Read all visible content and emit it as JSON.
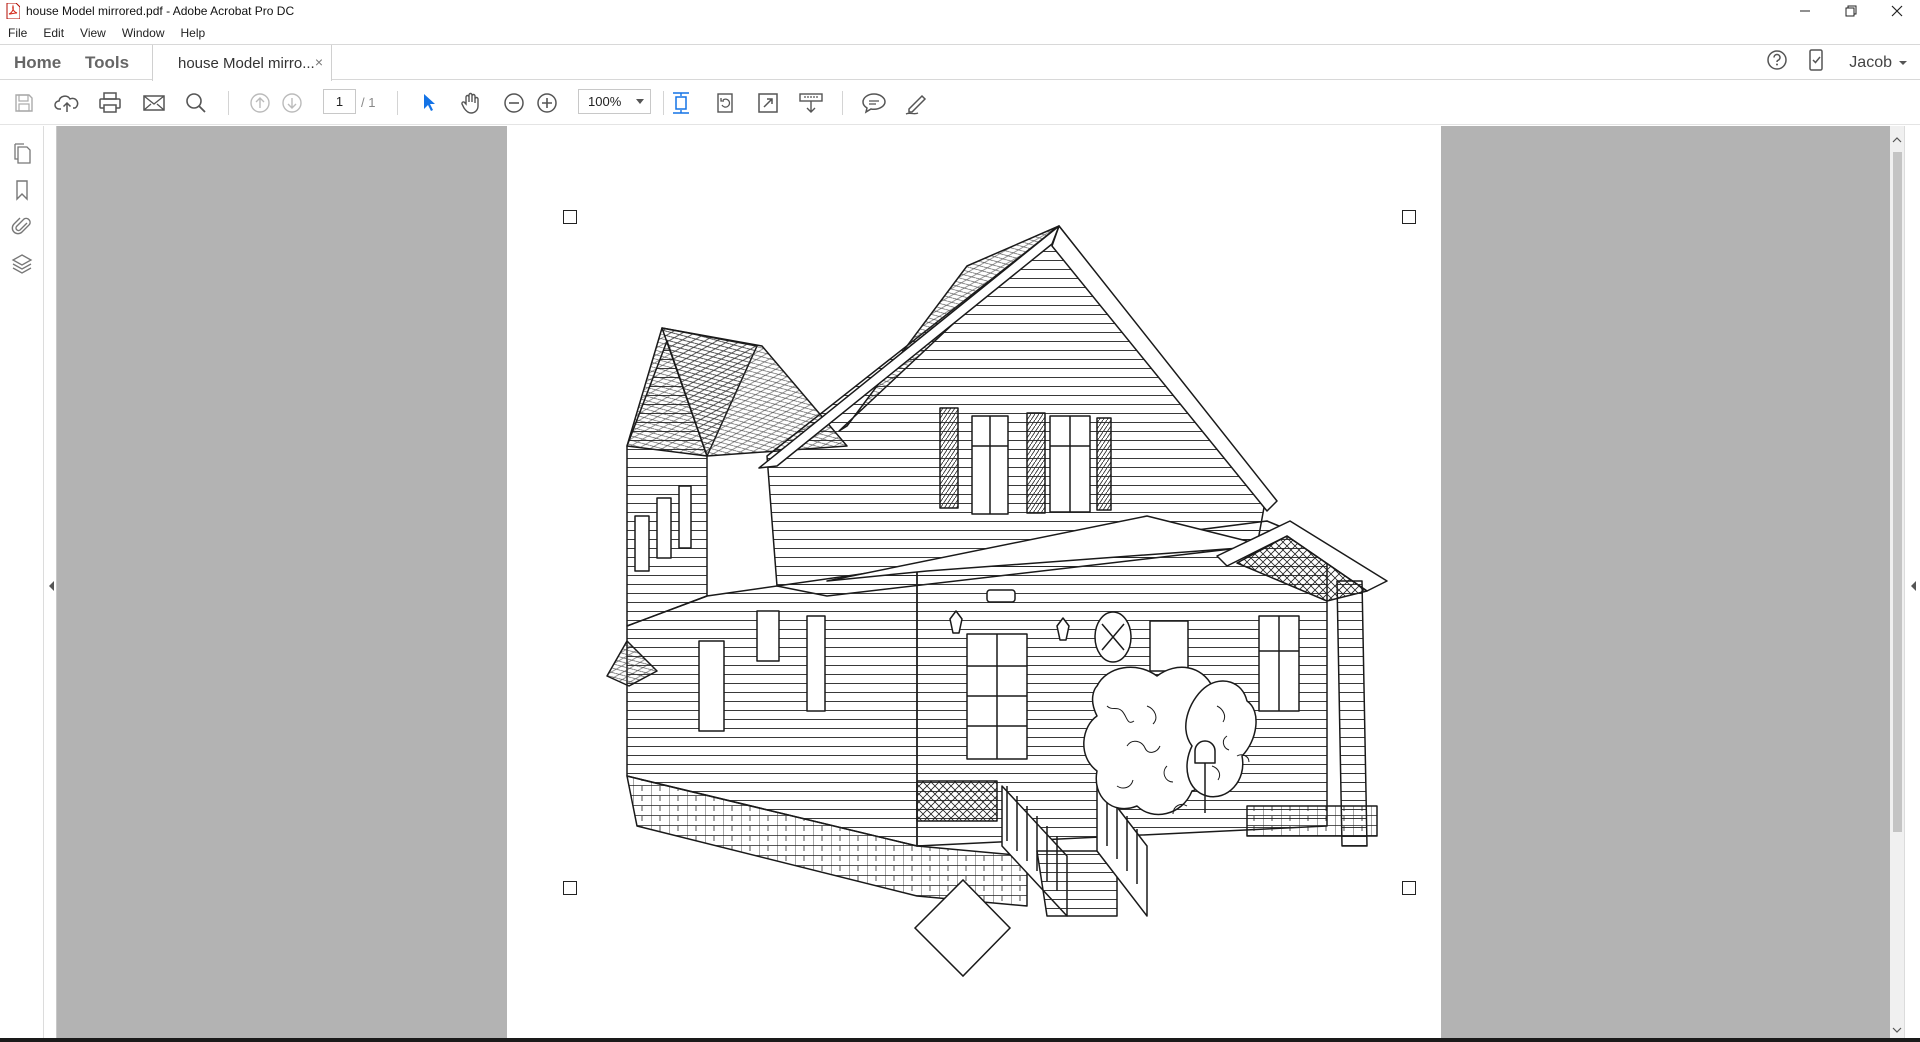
{
  "window": {
    "title": "house Model mirrored.pdf - Adobe Acrobat Pro DC",
    "controls": {
      "minimize": "—",
      "restore": "❐",
      "close": "✕"
    }
  },
  "menu": {
    "items": [
      "File",
      "Edit",
      "View",
      "Window",
      "Help"
    ]
  },
  "tabs": {
    "home": "Home",
    "tools": "Tools",
    "document": "house Model mirro...",
    "close": "×"
  },
  "account": {
    "user": "Jacob",
    "help_icon": "help-circle-icon",
    "mobile_icon": "mobile-link-icon"
  },
  "toolbar": {
    "page_current": "1",
    "page_total": "/ 1",
    "zoom": "100%",
    "icons": [
      "save-icon",
      "upload-cloud-icon",
      "print-icon",
      "email-icon",
      "search-icon",
      "prev-page-icon",
      "next-page-icon",
      "select-cursor-icon",
      "hand-icon",
      "zoom-out-icon",
      "zoom-in-icon",
      "fit-page-icon",
      "rotate-icon",
      "full-screen-icon",
      "read-mode-icon",
      "comment-icon",
      "sign-pen-icon"
    ]
  },
  "left_panel": {
    "icons": [
      "pages-icon",
      "bookmark-icon",
      "attachment-icon",
      "layers-icon"
    ]
  },
  "colors": {
    "canvas_bg": "#b3b3b3",
    "accent_blue": "#1473e6"
  }
}
